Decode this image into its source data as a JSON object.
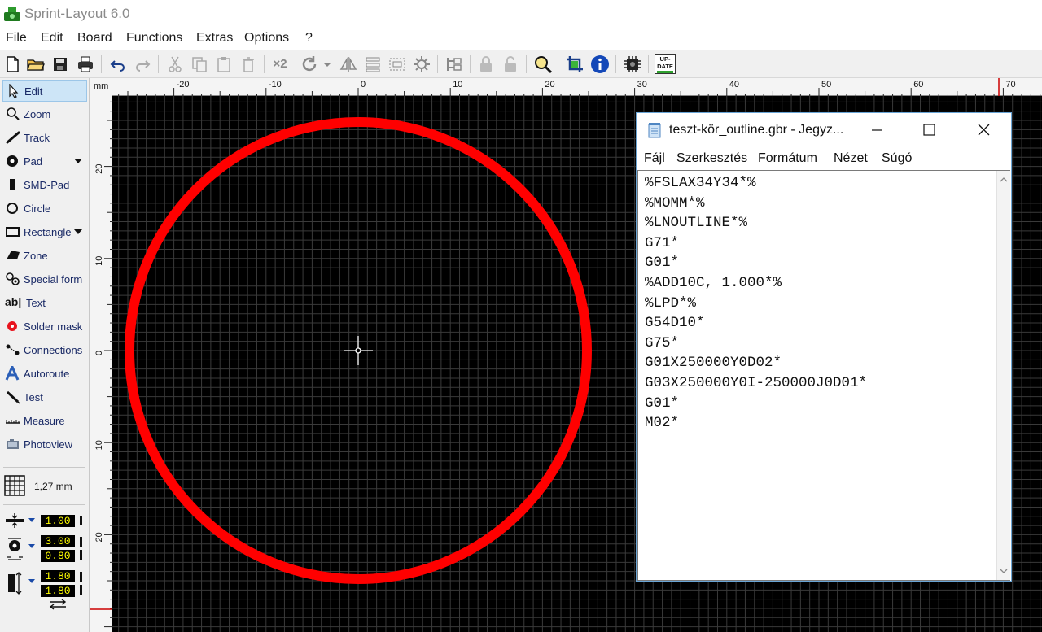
{
  "app": {
    "title": "Sprint-Layout 6.0",
    "colors": {
      "canvas": "#000000",
      "grid": "#3a3a3a",
      "circle": "#ff0000",
      "value_box_bg": "#000000",
      "value_box_fg": "#ffff00"
    }
  },
  "menu": {
    "items": [
      "File",
      "Edit",
      "Board",
      "Functions",
      "Extras",
      "Options",
      "?"
    ]
  },
  "toolbar": {
    "icons": [
      "new-file-icon",
      "open-folder-icon",
      "save-icon",
      "print-icon",
      "undo-icon",
      "redo-icon",
      "cut-icon",
      "copy-icon",
      "paste-icon",
      "delete-icon",
      "duplicate-icon",
      "rotate-icon",
      "mirror-icon",
      "align-icon",
      "group-icon",
      "settings-icon",
      "mask-icon",
      "lock-icon",
      "unlock-icon",
      "zoom-icon",
      "crop-icon",
      "info-icon",
      "chip-icon",
      "update-icon"
    ],
    "duplicate_label": "×2",
    "update_label_1": "UP-",
    "update_label_2": "DATE"
  },
  "tools": [
    {
      "label": "Edit",
      "icon": "cursor-icon",
      "active": true
    },
    {
      "label": "Zoom",
      "icon": "magnifier-icon"
    },
    {
      "label": "Track",
      "icon": "track-icon"
    },
    {
      "label": "Pad",
      "icon": "pad-icon",
      "dropdown": true
    },
    {
      "label": "SMD-Pad",
      "icon": "smd-pad-icon"
    },
    {
      "label": "Circle",
      "icon": "circle-icon"
    },
    {
      "label": "Rectangle",
      "icon": "rectangle-icon",
      "dropdown": true
    },
    {
      "label": "Zone",
      "icon": "zone-icon"
    },
    {
      "label": "Special form",
      "icon": "special-form-icon"
    },
    {
      "label": "Text",
      "icon": "text-icon",
      "prefix": "ab|"
    },
    {
      "label": "Solder mask",
      "icon": "solder-mask-icon"
    },
    {
      "label": "Connections",
      "icon": "connections-icon"
    },
    {
      "label": "Autoroute",
      "icon": "autoroute-icon"
    },
    {
      "label": "Test",
      "icon": "test-icon"
    },
    {
      "label": "Measure",
      "icon": "measure-icon"
    },
    {
      "label": "Photoview",
      "icon": "photoview-icon"
    }
  ],
  "grid": {
    "label": "1,27 mm"
  },
  "values": {
    "track_width": "1.00",
    "pad_outer": "3.00",
    "pad_inner": "0.80",
    "smd_width": "1.80",
    "smd_height": "1.80"
  },
  "ruler": {
    "unit": "mm",
    "top_labels": [
      "-20",
      "-10",
      "0",
      "10",
      "20",
      "30",
      "40",
      "50",
      "60",
      "70"
    ],
    "left_labels": [
      "20",
      "10",
      "0",
      "10",
      "20"
    ]
  },
  "notepad": {
    "title": "teszt-kör_outline.gbr - Jegyz...",
    "menu": [
      "Fájl",
      "Szerkesztés",
      "Formátum",
      "Nézet",
      "Súgó"
    ],
    "text": "%FSLAX34Y34*%\n%MOMM*%\n%LNOUTLINE*%\nG71*\nG01*\n%ADD10C, 1.000*%\n%LPD*%\nG54D10*\nG75*\nG01X250000Y0D02*\nG03X250000Y0I-250000J0D01*\nG01*\nM02*"
  }
}
